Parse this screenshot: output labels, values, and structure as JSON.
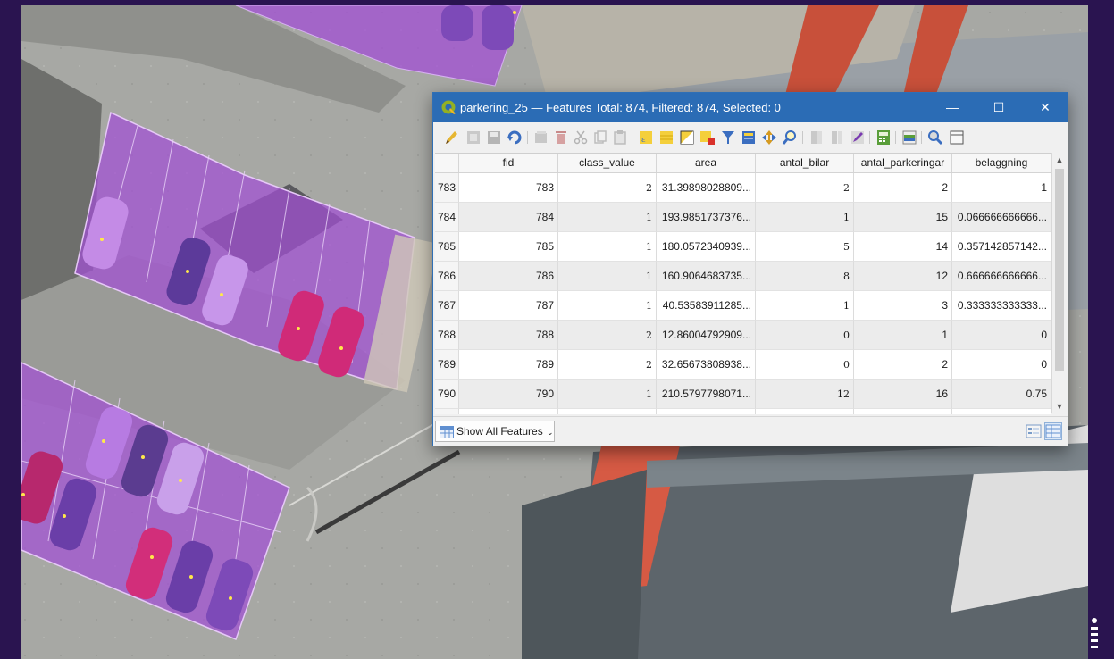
{
  "window": {
    "title": "parkering_25 — Features Total: 874, Filtered: 874, Selected: 0",
    "minimize": "—",
    "maximize": "☐",
    "close": "✕"
  },
  "toolbar": {
    "icons": [
      "pencil-icon",
      "toggle-multi-edit-icon",
      "save-edits-icon",
      "reload-icon",
      "add-feature-icon",
      "delete-feature-icon",
      "cut-icon",
      "copy-icon",
      "paste-icon",
      "select-by-expression-icon",
      "select-all-icon",
      "invert-selection-icon",
      "deselect-icon",
      "filter-icon",
      "move-selection-top-icon",
      "pan-to-selection-icon",
      "zoom-to-selection-icon",
      "new-field-icon",
      "delete-field-icon",
      "field-calculator-icon",
      "conditional-formatting-icon",
      "actions-icon",
      "dock-icon",
      "organize-columns-icon"
    ]
  },
  "table": {
    "columns": [
      "fid",
      "class_value",
      "area",
      "antal_bilar",
      "antal_parkeringar",
      "belaggning"
    ],
    "rows": [
      {
        "row_id": "783",
        "fid": "783",
        "class_value": "2",
        "area": "31.39898028809...",
        "antal_bilar": "2",
        "antal_parkeringar": "2",
        "belaggning": "1"
      },
      {
        "row_id": "784",
        "fid": "784",
        "class_value": "1",
        "area": "193.9851737376...",
        "antal_bilar": "1",
        "antal_parkeringar": "15",
        "belaggning": "0.066666666666..."
      },
      {
        "row_id": "785",
        "fid": "785",
        "class_value": "1",
        "area": "180.0572340939...",
        "antal_bilar": "5",
        "antal_parkeringar": "14",
        "belaggning": "0.357142857142..."
      },
      {
        "row_id": "786",
        "fid": "786",
        "class_value": "1",
        "area": "160.9064683735...",
        "antal_bilar": "8",
        "antal_parkeringar": "12",
        "belaggning": "0.666666666666..."
      },
      {
        "row_id": "787",
        "fid": "787",
        "class_value": "1",
        "area": "40.53583911285...",
        "antal_bilar": "1",
        "antal_parkeringar": "3",
        "belaggning": "0.333333333333..."
      },
      {
        "row_id": "788",
        "fid": "788",
        "class_value": "2",
        "area": "12.86004792909...",
        "antal_bilar": "0",
        "antal_parkeringar": "1",
        "belaggning": "0"
      },
      {
        "row_id": "789",
        "fid": "789",
        "class_value": "2",
        "area": "32.65673808938...",
        "antal_bilar": "0",
        "antal_parkeringar": "2",
        "belaggning": "0"
      },
      {
        "row_id": "790",
        "fid": "790",
        "class_value": "1",
        "area": "210.5797798071...",
        "antal_bilar": "12",
        "antal_parkeringar": "16",
        "belaggning": "0.75"
      }
    ]
  },
  "footer": {
    "show_all_label": "Show All Features",
    "view_icons": [
      "form-view-icon",
      "table-view-icon"
    ]
  },
  "colors": {
    "titlebar": "#2b6cb5",
    "page_frame": "#2a1450",
    "parking_polygon": "#a24fd4"
  }
}
